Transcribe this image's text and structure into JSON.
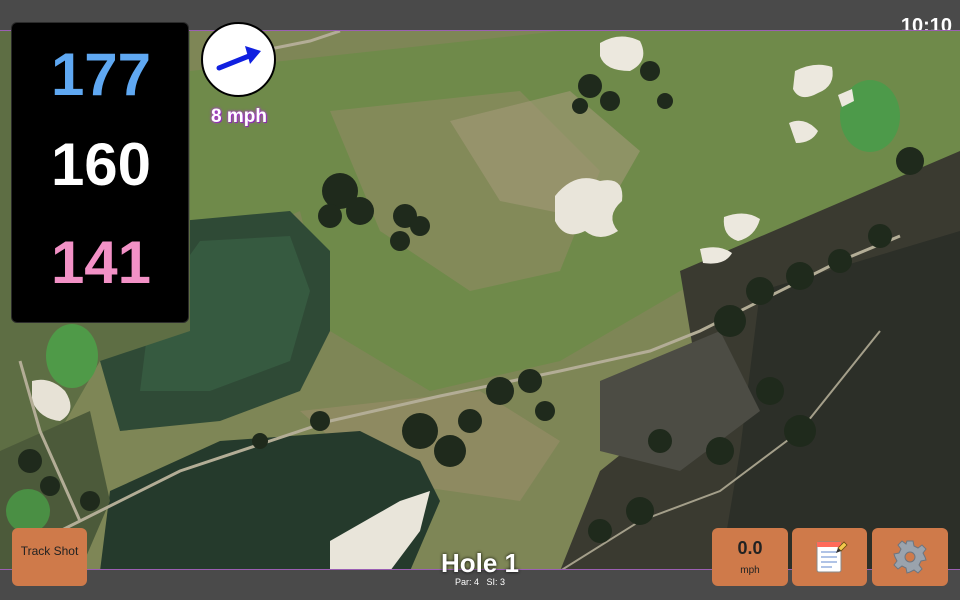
{
  "status": {
    "time": "10:10"
  },
  "distances": {
    "back": "177",
    "middle": "160",
    "front": "141"
  },
  "wind": {
    "speed": "8 mph",
    "icon": "wind-direction-arrow-icon"
  },
  "hole": {
    "title": "Hole 1",
    "par": "Par: 4",
    "si": "SI: 3"
  },
  "buttons": {
    "track_shot": "Track Shot",
    "speed_value": "0.0",
    "speed_unit": "mph",
    "notes_icon": "notepad-icon",
    "settings_icon": "gear-icon"
  },
  "colors": {
    "back_distance": "#5fa8f2",
    "middle_distance": "#ffffff",
    "front_distance": "#f291c6",
    "button": "#cf7a4a",
    "wind_text_glow": "#b03ad6"
  }
}
